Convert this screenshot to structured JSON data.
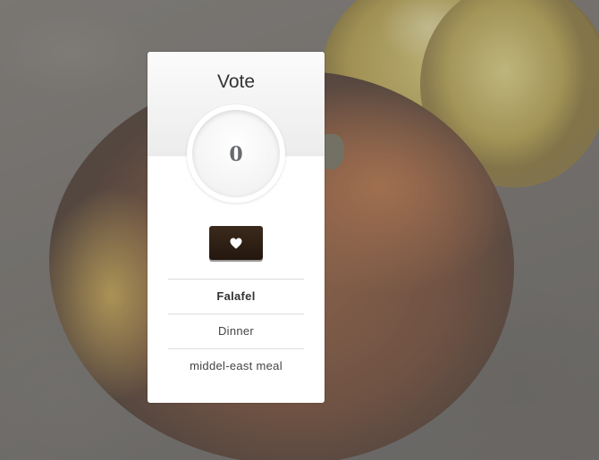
{
  "card": {
    "title": "Vote",
    "vote_count": "0",
    "vote_button_icon": "heart-icon",
    "details": {
      "name": "Falafel",
      "category": "Dinner",
      "description": "middel-east meal"
    }
  },
  "colors": {
    "button_bg": "#2b1c10",
    "card_bg": "#ffffff",
    "header_bg": "#efefef"
  }
}
